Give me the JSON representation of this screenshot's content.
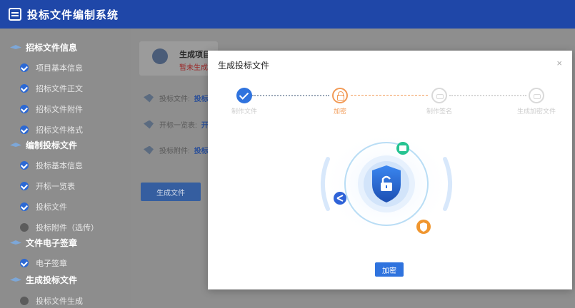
{
  "app": {
    "title": "投标文件编制系统"
  },
  "sidebar": {
    "sections": [
      {
        "label": "招标文件信息",
        "items": [
          {
            "label": "项目基本信息",
            "status": "done"
          },
          {
            "label": "招标文件正文",
            "status": "done"
          },
          {
            "label": "招标文件附件",
            "status": "done"
          },
          {
            "label": "招标文件格式",
            "status": "done"
          }
        ]
      },
      {
        "label": "编制投标文件",
        "items": [
          {
            "label": "投标基本信息",
            "status": "done"
          },
          {
            "label": "开标一览表",
            "status": "done"
          },
          {
            "label": "投标文件",
            "status": "done"
          },
          {
            "label": "投标附件（选传）",
            "status": "pending"
          }
        ]
      },
      {
        "label": "文件电子签章",
        "items": [
          {
            "label": "电子签章",
            "status": "done"
          }
        ]
      },
      {
        "label": "生成投标文件",
        "items": [
          {
            "label": "投标文件生成",
            "status": "pending"
          }
        ]
      }
    ]
  },
  "main": {
    "card_title": "生成项目",
    "card_subtitle": "暂未生成",
    "rows": [
      {
        "label": "投标文件:",
        "link": "投标"
      },
      {
        "label": "开标一览表:",
        "link": "开"
      },
      {
        "label": "投标附件:",
        "link": "投标"
      }
    ],
    "generate_button": "生成文件"
  },
  "modal": {
    "title": "生成投标文件",
    "close": "×",
    "steps": [
      {
        "label": "制作文件",
        "state": "done"
      },
      {
        "label": "加密",
        "state": "active"
      },
      {
        "label": "制作签名",
        "state": "waiting"
      },
      {
        "label": "生成加密文件",
        "state": "waiting"
      }
    ],
    "primary_button": "加密"
  },
  "colors": {
    "header": "#1f47a8",
    "primary": "#2f73de",
    "active_step": "#f29b57",
    "shield_top": "#2a6fe0",
    "shield_bottom": "#1d4fb2",
    "green_node": "#25c391",
    "orange_node": "#f0962f",
    "blue_node": "#2f63d8"
  },
  "icons": {
    "shield": "lock-shield-icon",
    "share": "share-icon",
    "image": "image-icon",
    "guard": "shield-small-icon"
  }
}
